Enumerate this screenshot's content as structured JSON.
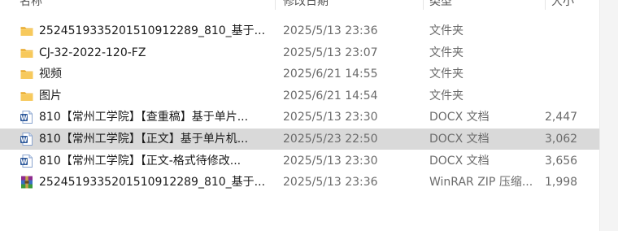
{
  "columns": {
    "name": "名称",
    "modified": "修改日期",
    "type": "类型",
    "size": "大小"
  },
  "files": [
    {
      "name": "2524519335201510912289_810_基于...",
      "modified": "2025/5/13 23:36",
      "type": "文件夹",
      "size": "",
      "icon": "folder-icon"
    },
    {
      "name": "CJ-32-2022-120-FZ",
      "modified": "2025/5/13 23:07",
      "type": "文件夹",
      "size": "",
      "icon": "folder-icon"
    },
    {
      "name": "视频",
      "modified": "2025/6/21 14:55",
      "type": "文件夹",
      "size": "",
      "icon": "folder-icon"
    },
    {
      "name": "图片",
      "modified": "2025/6/21 14:54",
      "type": "文件夹",
      "size": "",
      "icon": "folder-icon"
    },
    {
      "name": "810【常州工学院】【查重稿】基于单片...",
      "modified": "2025/5/13 23:30",
      "type": "DOCX 文档",
      "size": "2,447",
      "icon": "word-doc-icon"
    },
    {
      "name": "810【常州工学院】【正文】基于单片机...",
      "modified": "2025/5/23 22:50",
      "type": "DOCX 文档",
      "size": "3,062",
      "icon": "word-doc-icon",
      "selected": true
    },
    {
      "name": "810【常州工学院】【正文-格式待修改...",
      "modified": "2025/5/13 23:30",
      "type": "DOCX 文档",
      "size": "3,656",
      "icon": "word-doc-icon"
    },
    {
      "name": "2524519335201510912289_810_基于...",
      "modified": "2025/5/13 23:36",
      "type": "WinRAR ZIP 压缩...",
      "size": "1,998",
      "icon": "winrar-archive-icon"
    }
  ],
  "colors": {
    "folder": "#f5c04a",
    "word": "#2b579a",
    "selection": "#d9d9d9"
  }
}
